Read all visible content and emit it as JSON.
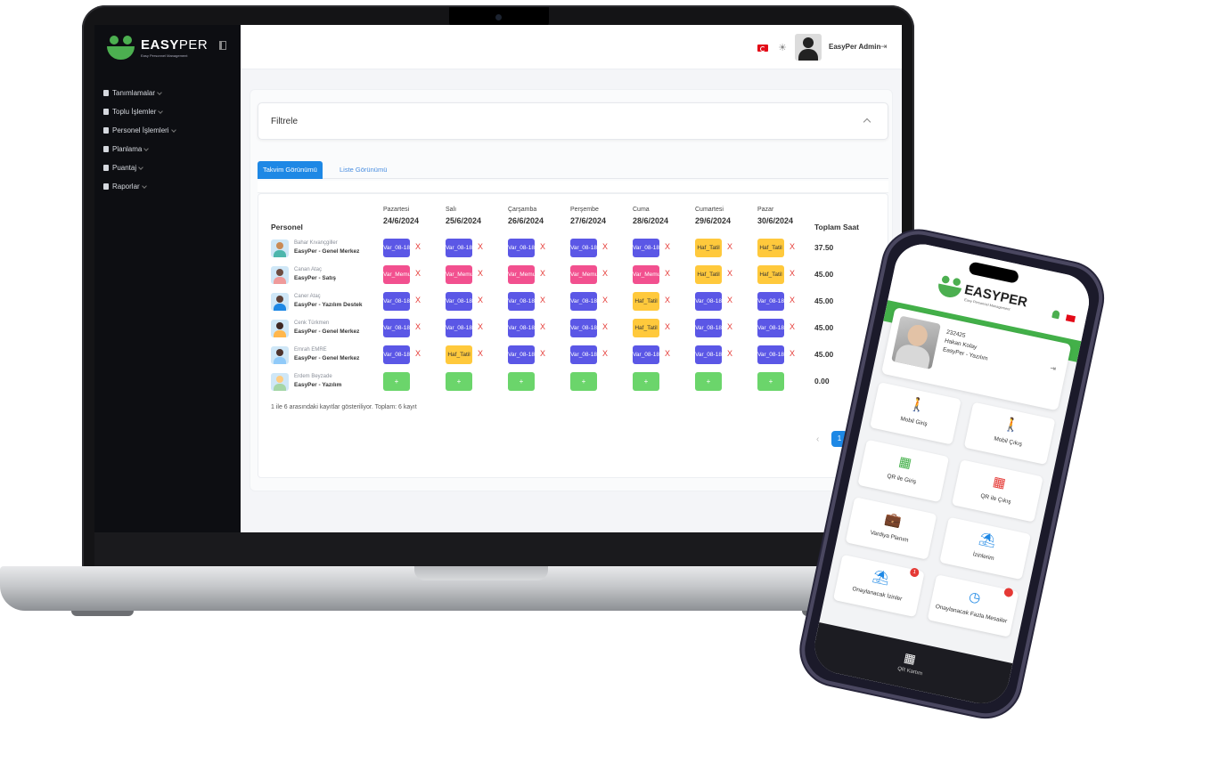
{
  "laptop": {
    "brand": "EASYPER",
    "brand_bold": "EASY",
    "brand_thin": "PER",
    "brand_sub": "Easy Personnel Management",
    "nav": [
      {
        "label": "Tanımlamalar",
        "icon": "gear-icon"
      },
      {
        "label": "Toplu İşlemler",
        "icon": "file-icon"
      },
      {
        "label": "Personel İşlemleri",
        "icon": "users-icon"
      },
      {
        "label": "Planlama",
        "icon": "file-icon"
      },
      {
        "label": "Puantaj",
        "icon": "file-icon"
      },
      {
        "label": "Raporlar",
        "icon": "file-icon"
      }
    ],
    "topbar": {
      "admin_name": "EasyPer Admin",
      "logout_icon": "logout-icon"
    },
    "filter": {
      "label": "Filtrele"
    },
    "tabs": {
      "active": "Takvim Görünümü",
      "inactive": "Liste Görünümü"
    },
    "table": {
      "col_personel": "Personel",
      "col_total": "Toplam Saat",
      "days": [
        {
          "name": "Pazartesi",
          "date": "24/6/2024"
        },
        {
          "name": "Salı",
          "date": "25/6/2024"
        },
        {
          "name": "Çarşamba",
          "date": "26/6/2024"
        },
        {
          "name": "Perşembe",
          "date": "27/6/2024"
        },
        {
          "name": "Cuma",
          "date": "28/6/2024"
        },
        {
          "name": "Cumartesi",
          "date": "29/6/2024"
        },
        {
          "name": "Pazar",
          "date": "30/6/2024"
        }
      ],
      "rows": [
        {
          "name": "Bahar Kıvançgiller",
          "dept": "EasyPer - Genel Merkez",
          "total": "37.50",
          "shifts": [
            "Var_08-18",
            "Var_08-18",
            "Var_08-18",
            "Var_08-18",
            "Var_08-18",
            "Haf_Tatil",
            "Haf_Tatil"
          ]
        },
        {
          "name": "Canan Ataç",
          "dept": "EasyPer - Satış",
          "total": "45.00",
          "shifts": [
            "Var_Memur",
            "Var_Memur",
            "Var_Memur",
            "Var_Memur",
            "Var_Memur",
            "Haf_Tatil",
            "Haf_Tatil"
          ]
        },
        {
          "name": "Caner Ataç",
          "dept": "EasyPer - Yazılım Destek",
          "total": "45.00",
          "shifts": [
            "Var_08-18",
            "Var_08-18",
            "Var_08-18",
            "Var_08-18",
            "Haf_Tatil",
            "Var_08-18",
            "Var_08-18"
          ]
        },
        {
          "name": "Cenk Türkmen",
          "dept": "EasyPer - Genel Merkez",
          "total": "45.00",
          "shifts": [
            "Var_08-18",
            "Var_08-18",
            "Var_08-18",
            "Var_08-18",
            "Haf_Tatil",
            "Var_08-18",
            "Var_08-18"
          ]
        },
        {
          "name": "Emrah EMRE",
          "dept": "EasyPer - Genel Merkez",
          "total": "45.00",
          "shifts": [
            "Var_08-18",
            "Haf_Tatil",
            "Var_08-18",
            "Var_08-18",
            "Var_08-18",
            "Var_08-18",
            "Var_08-18"
          ]
        },
        {
          "name": "Erdem Beyzade",
          "dept": "EasyPer - Yazılım",
          "total": "0.00",
          "shifts": [
            "+",
            "+",
            "+",
            "+",
            "+",
            "+",
            "+"
          ]
        }
      ],
      "remove_mark": "X",
      "footer": "1 ile 6 arasındaki kayıtlar gösteriliyor. Toplam: 6 kayıt",
      "page": "1"
    },
    "colors": {
      "blue": "#5b57e6",
      "pink": "#f2508f",
      "yellow": "#ffc93c",
      "green": "#6bd56b",
      "accent": "#1e88e5"
    }
  },
  "phone": {
    "brand": "EASYPER",
    "brand_sub": "Easy Personnel Management",
    "profile": {
      "id": "232425",
      "name": "Hakan Kolay",
      "dept": "EasyPer - Yazılım"
    },
    "tiles": [
      {
        "label": "Mobil Giriş",
        "icon": "walk-in-icon",
        "color": "#43b049"
      },
      {
        "label": "Mobil Çıkış",
        "icon": "walk-out-icon",
        "color": "#e53935"
      },
      {
        "label": "QR ile Giriş",
        "icon": "qr-icon",
        "color": "#43b049"
      },
      {
        "label": "QR ile Çıkış",
        "icon": "qr-icon",
        "color": "#e53935"
      },
      {
        "label": "Vardiya Planım",
        "icon": "briefcase-icon",
        "color": "#1e88e5"
      },
      {
        "label": "İzinlerim",
        "icon": "umbrella-icon",
        "color": "#1e88e5"
      },
      {
        "label": "Onaylanacak İzinler",
        "icon": "umbrella-icon",
        "color": "#1e88e5",
        "badge": "1"
      },
      {
        "label": "Onaylanacak Fazla Mesailer",
        "icon": "clock-icon",
        "color": "#1e88e5",
        "badge": ""
      }
    ],
    "bottom": {
      "label": "QR Kartım",
      "icon": "qr-icon"
    }
  }
}
